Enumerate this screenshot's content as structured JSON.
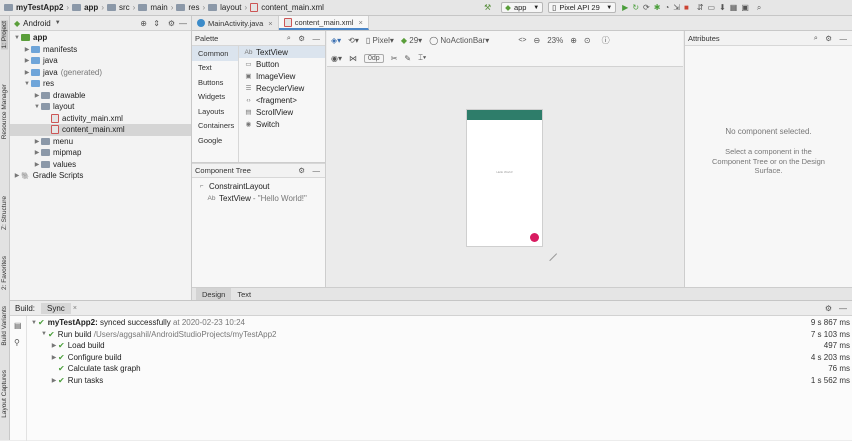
{
  "breadcrumbs": [
    "myTestApp2",
    "app",
    "src",
    "main",
    "res",
    "layout",
    "content_main.xml"
  ],
  "toolbar": {
    "run_config": "app",
    "device": "Pixel API 29"
  },
  "left_strip": {
    "tabs": [
      "1: Project",
      "Resource Manager",
      "Z: Structure",
      "2: Favorites",
      "Build Variants",
      "Layout Captures"
    ]
  },
  "project": {
    "view": "Android",
    "tree": [
      {
        "label": "app",
        "depth": 0,
        "bold": true,
        "kind": "module",
        "expanded": true
      },
      {
        "label": "manifests",
        "depth": 1,
        "kind": "folder-blue",
        "expanded": false
      },
      {
        "label": "java",
        "depth": 1,
        "kind": "folder-blue",
        "expanded": false
      },
      {
        "label": "java",
        "suffix": "(generated)",
        "depth": 1,
        "kind": "folder-blue",
        "expanded": false
      },
      {
        "label": "res",
        "depth": 1,
        "kind": "folder-blue",
        "expanded": true
      },
      {
        "label": "drawable",
        "depth": 2,
        "kind": "folder",
        "expanded": false
      },
      {
        "label": "layout",
        "depth": 2,
        "kind": "folder",
        "expanded": true
      },
      {
        "label": "activity_main.xml",
        "depth": 3,
        "kind": "xml"
      },
      {
        "label": "content_main.xml",
        "depth": 3,
        "kind": "xml",
        "selected": true
      },
      {
        "label": "menu",
        "depth": 2,
        "kind": "folder",
        "expanded": false
      },
      {
        "label": "mipmap",
        "depth": 2,
        "kind": "folder",
        "expanded": false
      },
      {
        "label": "values",
        "depth": 2,
        "kind": "folder",
        "expanded": false
      },
      {
        "label": "Gradle Scripts",
        "depth": 0,
        "kind": "gradle",
        "expanded": false
      }
    ]
  },
  "editor_tabs": [
    {
      "label": "MainActivity.java",
      "kind": "java",
      "active": false
    },
    {
      "label": "content_main.xml",
      "kind": "xml",
      "active": true
    }
  ],
  "palette": {
    "title": "Palette",
    "categories": [
      "Common",
      "Text",
      "Buttons",
      "Widgets",
      "Layouts",
      "Containers",
      "Google"
    ],
    "items": [
      {
        "icon": "Ab",
        "label": "TextView"
      },
      {
        "icon": "▭",
        "label": "Button"
      },
      {
        "icon": "▣",
        "label": "ImageView"
      },
      {
        "icon": "☰",
        "label": "RecyclerView"
      },
      {
        "icon": "‹›",
        "label": "<fragment>"
      },
      {
        "icon": "▤",
        "label": "ScrollView"
      },
      {
        "icon": "◉",
        "label": "Switch"
      }
    ]
  },
  "component_tree": {
    "title": "Component Tree",
    "root": "ConstraintLayout",
    "child_icon": "Ab",
    "child_label": "TextView",
    "child_value": "- \"Hello World!\""
  },
  "design_toolbar": {
    "device": "Pixel",
    "api": "29",
    "theme": "NoActionBar",
    "zoom": "23%",
    "margin": "0dp"
  },
  "canvas": {
    "phone_text": "Hello World!"
  },
  "attributes": {
    "title": "Attributes",
    "empty_title": "No component selected.",
    "empty_hint": "Select a component in the Component Tree or on the Design Surface."
  },
  "design_tabs": [
    "Design",
    "Text"
  ],
  "build": {
    "label": "Build:",
    "tab": "Sync",
    "rows": [
      {
        "depth": 0,
        "expanded": true,
        "bold_text": "myTestApp2:",
        "text": " synced successfully",
        "gray": " at 2020-02-23 10:24",
        "time": "9 s 867 ms"
      },
      {
        "depth": 1,
        "expanded": true,
        "bold_text": "",
        "text": "Run build",
        "gray": " /Users/aggsahil/AndroidStudioProjects/myTestApp2",
        "time": "7 s 103 ms"
      },
      {
        "depth": 2,
        "expanded": false,
        "bold_text": "",
        "text": "Load build",
        "gray": "",
        "time": "497 ms"
      },
      {
        "depth": 2,
        "expanded": false,
        "bold_text": "",
        "text": "Configure build",
        "gray": "",
        "time": "4 s 203 ms"
      },
      {
        "depth": 2,
        "expanded": null,
        "bold_text": "",
        "text": "Calculate task graph",
        "gray": "",
        "time": "76 ms"
      },
      {
        "depth": 2,
        "expanded": false,
        "bold_text": "",
        "text": "Run tasks",
        "gray": "",
        "time": "1 s 562 ms"
      }
    ]
  },
  "colors": {
    "app_bar": "#2e7d6a",
    "fab": "#d81b60",
    "success": "#4a9e3a",
    "selection": "#d5d5d5"
  }
}
